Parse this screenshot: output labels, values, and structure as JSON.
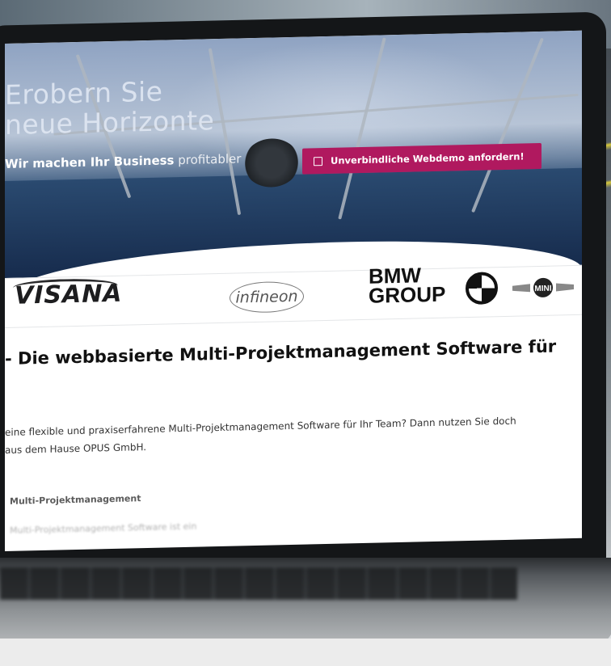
{
  "hero": {
    "title_line1": "Erobern Sie",
    "title_line2": "neue Horizonte",
    "subtitle_bold": "Wir machen Ihr Business",
    "subtitle_light": "profitabler",
    "cta_label": "Unverbindliche Webdemo anfordern!",
    "cta_color": "#b0195f"
  },
  "logos": {
    "visana": "VISANA",
    "infineon": "infineon",
    "bmw_line1": "BMW",
    "bmw_line2": "GROUP",
    "mini": "MINI"
  },
  "content": {
    "heading": "- Die webbasierte Multi-Projektmanagement Software für",
    "para_line1": "eine flexible und praxiserfahrene Multi-Projektmanagement Software für Ihr Team? Dann nutzen Sie doch",
    "para_line2": "aus dem Hause OPUS GmbH.",
    "subheading": "Multi-Projektmanagement",
    "blurred_text": "Multi-Projektmanagement Software ist ein"
  }
}
